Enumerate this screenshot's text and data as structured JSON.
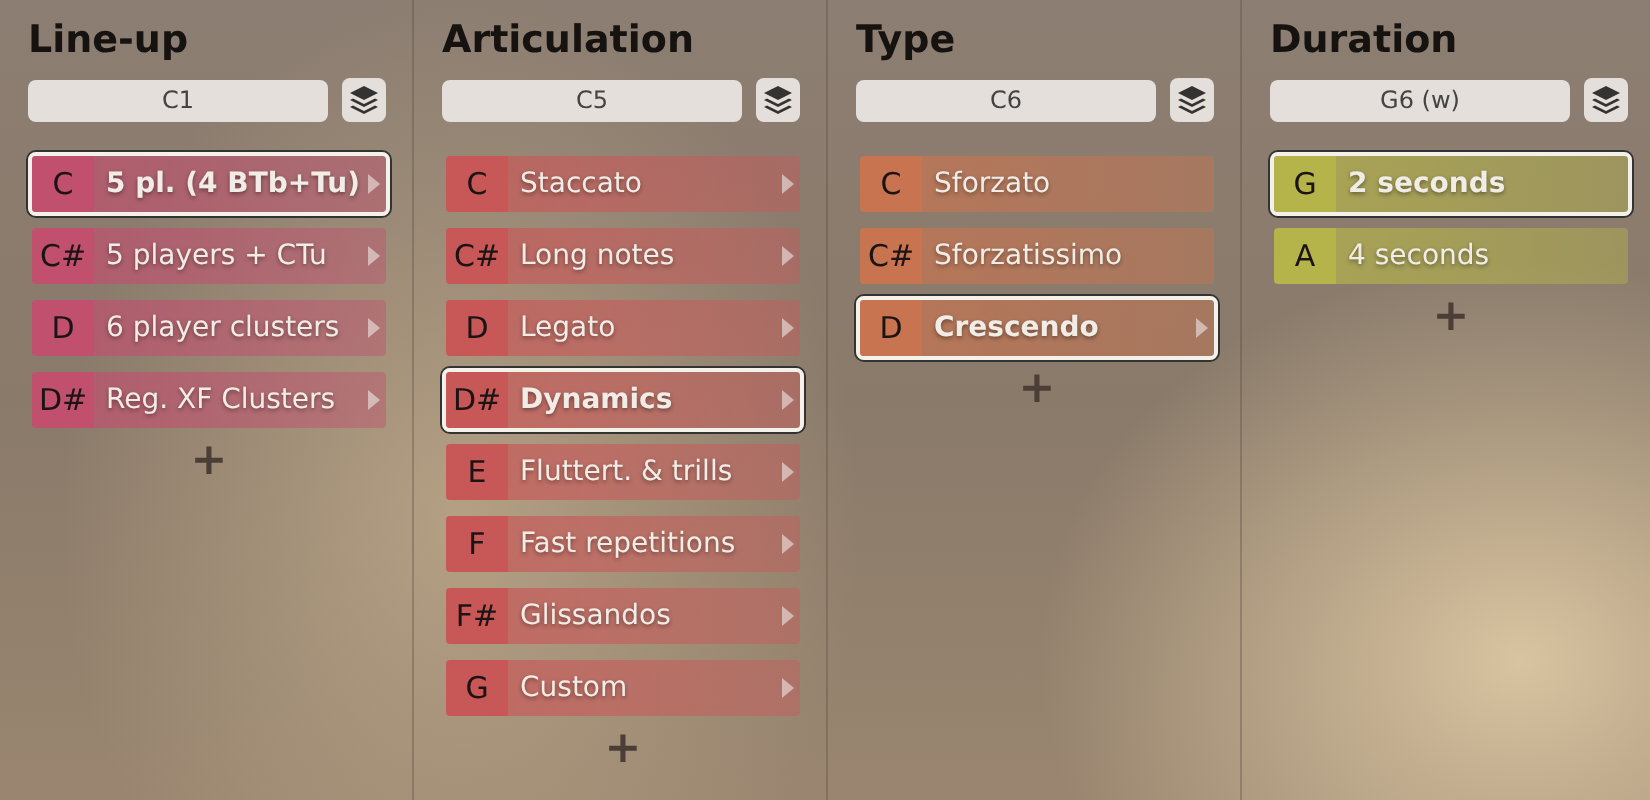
{
  "columns": [
    {
      "title": "Line-up",
      "key": "C1",
      "color": "#c0506e",
      "add": "+",
      "items": [
        {
          "note": "C",
          "label": "5 pl. (4 BTb+Tu)",
          "selected": true,
          "submenu": true
        },
        {
          "note": "C#",
          "label": "5 players + CTu",
          "selected": false,
          "submenu": true
        },
        {
          "note": "D",
          "label": "6 player clusters",
          "selected": false,
          "submenu": true
        },
        {
          "note": "D#",
          "label": "Reg. XF Clusters",
          "selected": false,
          "submenu": true
        }
      ]
    },
    {
      "title": "Articulation",
      "key": "C5",
      "color": "#c85858",
      "add": "+",
      "items": [
        {
          "note": "C",
          "label": "Staccato",
          "selected": false,
          "submenu": true
        },
        {
          "note": "C#",
          "label": "Long notes",
          "selected": false,
          "submenu": true
        },
        {
          "note": "D",
          "label": "Legato",
          "selected": false,
          "submenu": true
        },
        {
          "note": "D#",
          "label": "Dynamics",
          "selected": true,
          "submenu": true
        },
        {
          "note": "E",
          "label": "Fluttert. & trills",
          "selected": false,
          "submenu": true
        },
        {
          "note": "F",
          "label": "Fast repetitions",
          "selected": false,
          "submenu": true
        },
        {
          "note": "F#",
          "label": "Glissandos",
          "selected": false,
          "submenu": true
        },
        {
          "note": "G",
          "label": "Custom",
          "selected": false,
          "submenu": true
        }
      ]
    },
    {
      "title": "Type",
      "key": "C6",
      "color": "#c87450",
      "add": "+",
      "items": [
        {
          "note": "C",
          "label": "Sforzato",
          "selected": false,
          "submenu": false
        },
        {
          "note": "C#",
          "label": "Sforzatissimo",
          "selected": false,
          "submenu": false
        },
        {
          "note": "D",
          "label": "Crescendo",
          "selected": true,
          "submenu": true
        }
      ]
    },
    {
      "title": "Duration",
      "key": "G6 (w)",
      "color": "#b4b44a",
      "add": "+",
      "items": [
        {
          "note": "G",
          "label": "2 seconds",
          "selected": true,
          "submenu": false
        },
        {
          "note": "A",
          "label": "4 seconds",
          "selected": false,
          "submenu": false
        }
      ]
    }
  ]
}
